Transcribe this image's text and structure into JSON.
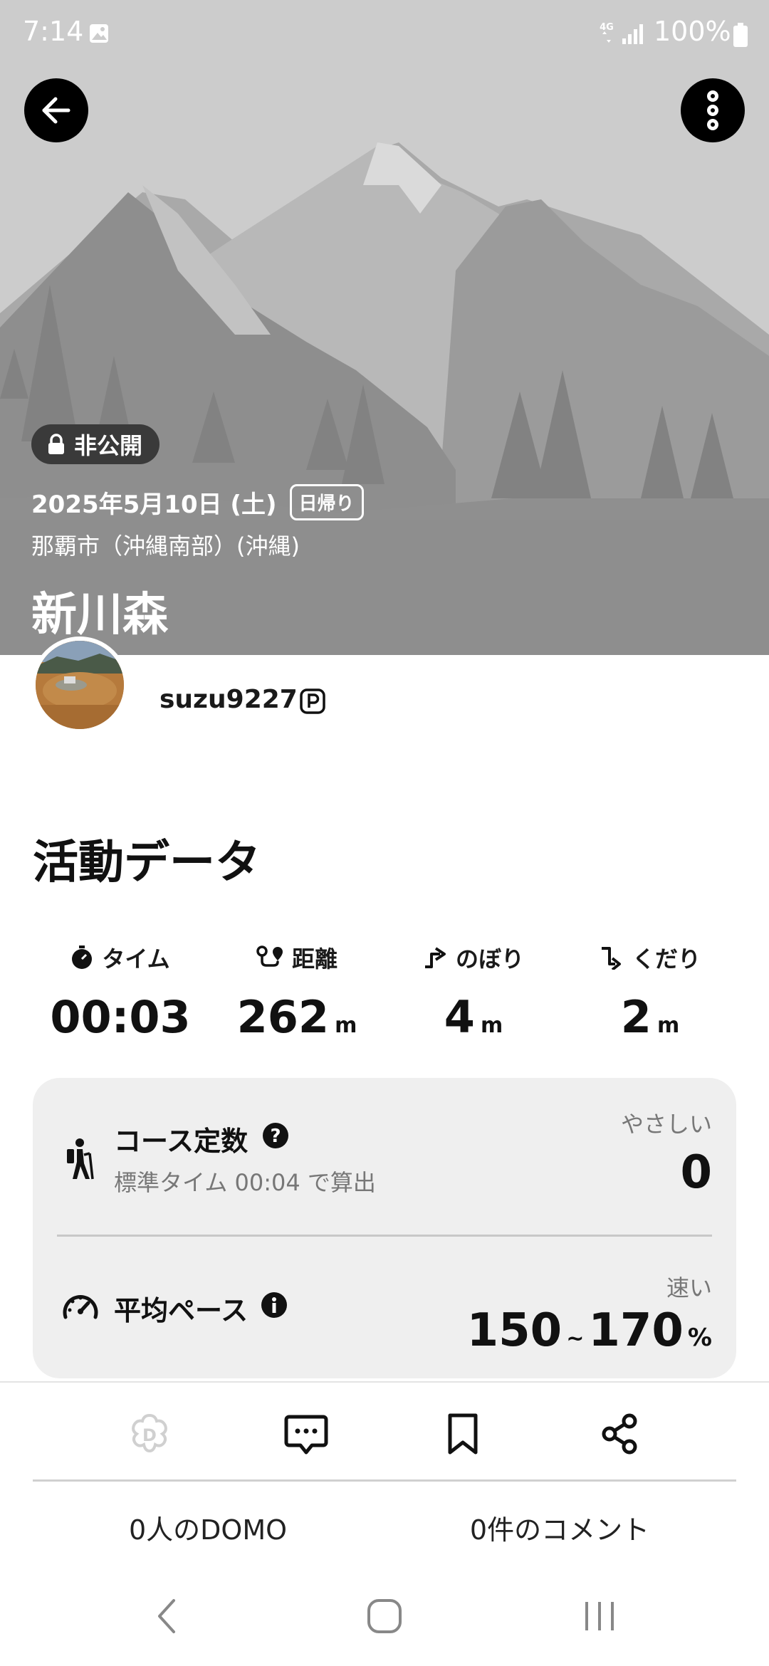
{
  "status_bar": {
    "time": "7:14",
    "network": "4G",
    "battery": "100%"
  },
  "header": {
    "privacy_label": "非公開",
    "date": "2025年5月10日 (土)",
    "trip_type": "日帰り",
    "location": "那覇市（沖縄南部）(沖縄)",
    "mountain_name": "新川森"
  },
  "user": {
    "username": "suzu9227"
  },
  "activity": {
    "section_title": "活動データ",
    "stats": [
      {
        "label": "タイム",
        "value": "00:03",
        "unit": "",
        "icon": "stopwatch-icon"
      },
      {
        "label": "距離",
        "value": "262",
        "unit": "m",
        "icon": "route-icon"
      },
      {
        "label": "のぼり",
        "value": "4",
        "unit": "m",
        "icon": "ascent-icon"
      },
      {
        "label": "くだり",
        "value": "2",
        "unit": "m",
        "icon": "descent-icon"
      }
    ],
    "course": {
      "title": "コース定数",
      "subtitle": "標準タイム 00:04 で算出",
      "level": "やさしい",
      "value": "0"
    },
    "pace": {
      "title": "平均ペース",
      "label": "速い",
      "low": "150",
      "separator": "~",
      "high": "170",
      "unit": "%"
    }
  },
  "actions": {
    "domo_count": "0人のDOMO",
    "comment_count": "0件のコメント"
  }
}
